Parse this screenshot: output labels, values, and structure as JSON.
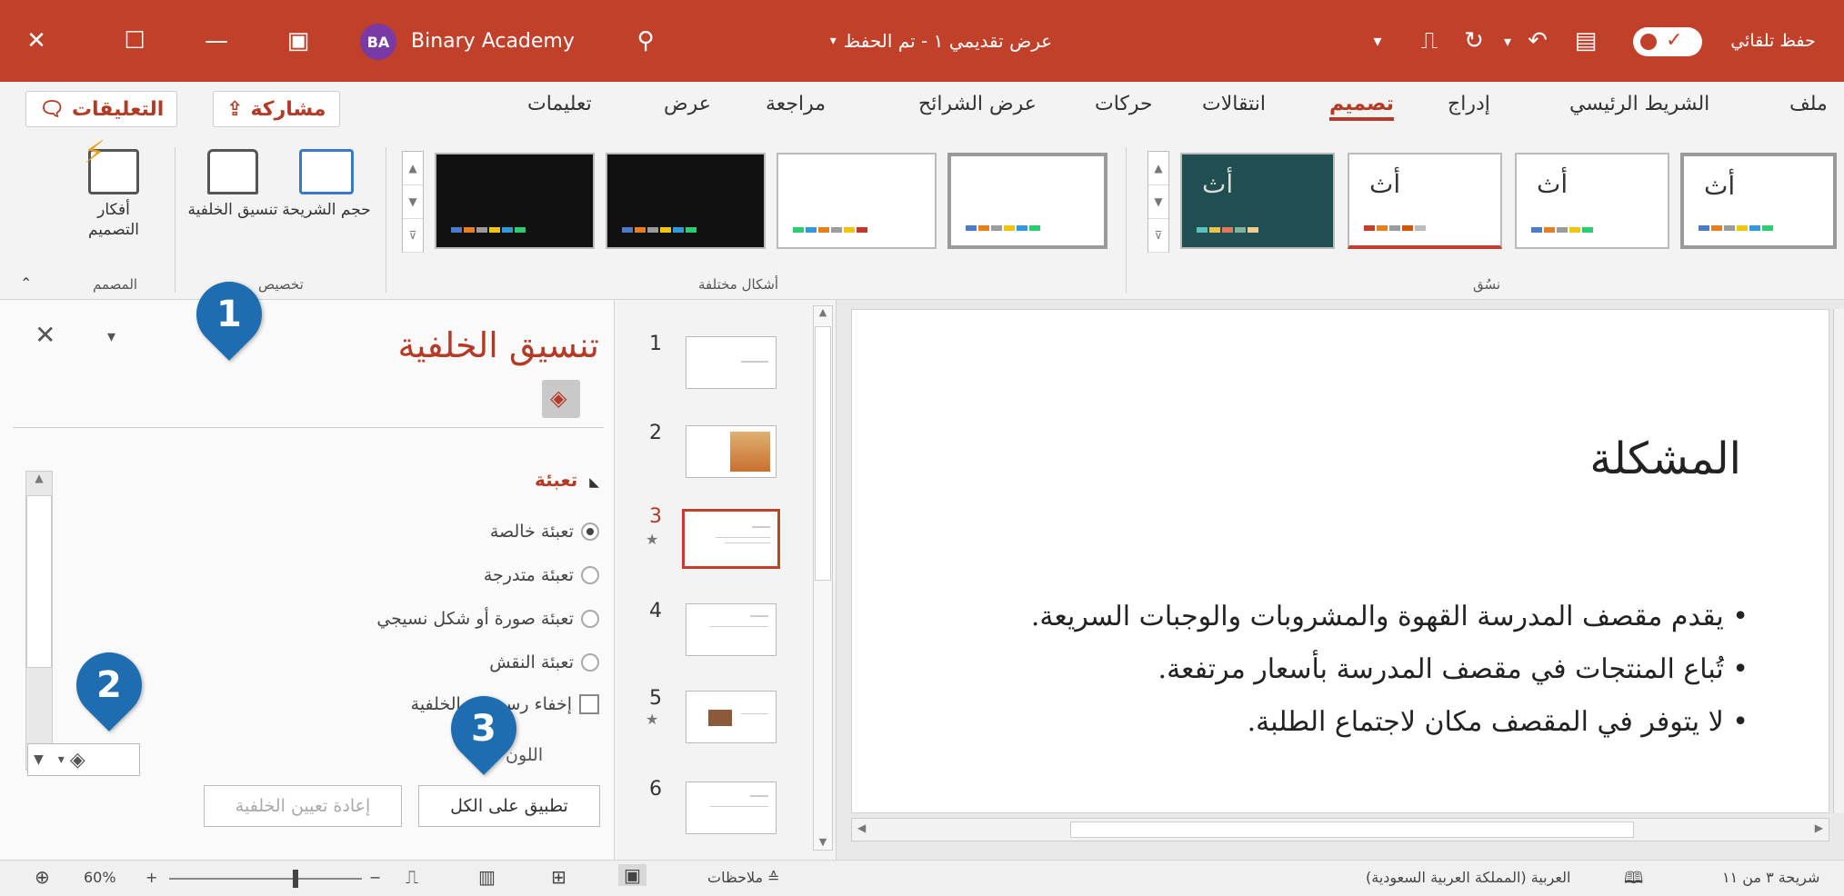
{
  "colors": {
    "accent": "#c1402a",
    "callout": "#1e6db0"
  },
  "titlebar": {
    "autosave_label": "حفظ تلقائي",
    "doc_title": "عرض تقديمي ١ - تم الحفظ",
    "user_initials": "BA",
    "user_name": "Binary Academy"
  },
  "menu": {
    "items": [
      "ملف",
      "الشريط الرئيسي",
      "إدراج",
      "تصميم",
      "انتقالات",
      "حركات",
      "عرض الشرائح",
      "مراجعة",
      "عرض",
      "تعليمات"
    ],
    "share": "مشاركة",
    "comments": "التعليقات"
  },
  "ribbon": {
    "themes_label": "نسُق",
    "variants_label": "أشكال مختلفة",
    "customize_label": "تخصيص",
    "designer_label": "المصمم",
    "slide_size": "حجم الشريحة",
    "format_background": "تنسيق الخلفية",
    "design_ideas": "أفكار التصميم",
    "theme_letter": "أث"
  },
  "pane": {
    "title": "تنسيق الخلفية",
    "fill_header": "تعبئة",
    "options": [
      "تعبئة خالصة",
      "تعبئة متدرجة",
      "تعبئة صورة أو شكل نسيجي",
      "تعبئة النقش"
    ],
    "hide_graphics": "إخفاء رسومات الخلفية",
    "color_label": "اللون",
    "apply_all": "تطبيق على الكل",
    "reset_bg": "إعادة تعيين الخلفية"
  },
  "slides": [
    {
      "num": "1"
    },
    {
      "num": "2"
    },
    {
      "num": "3"
    },
    {
      "num": "4"
    },
    {
      "num": "5"
    },
    {
      "num": "6"
    }
  ],
  "slide": {
    "title": "المشكلة",
    "bullets": [
      "• يقدم مقصف المدرسة القهوة والمشروبات والوجبات السريعة.",
      "• تُباع المنتجات في مقصف المدرسة بأسعار مرتفعة.",
      "• لا يتوفر في المقصف مكان لاجتماع الطلبة."
    ]
  },
  "status": {
    "slide_counter": "شريحة ٣ من ١١",
    "language": "العربية (المملكة العربية السعودية)",
    "notes": "ملاحظات",
    "zoom": "60%"
  },
  "callouts": [
    "1",
    "2",
    "3"
  ]
}
